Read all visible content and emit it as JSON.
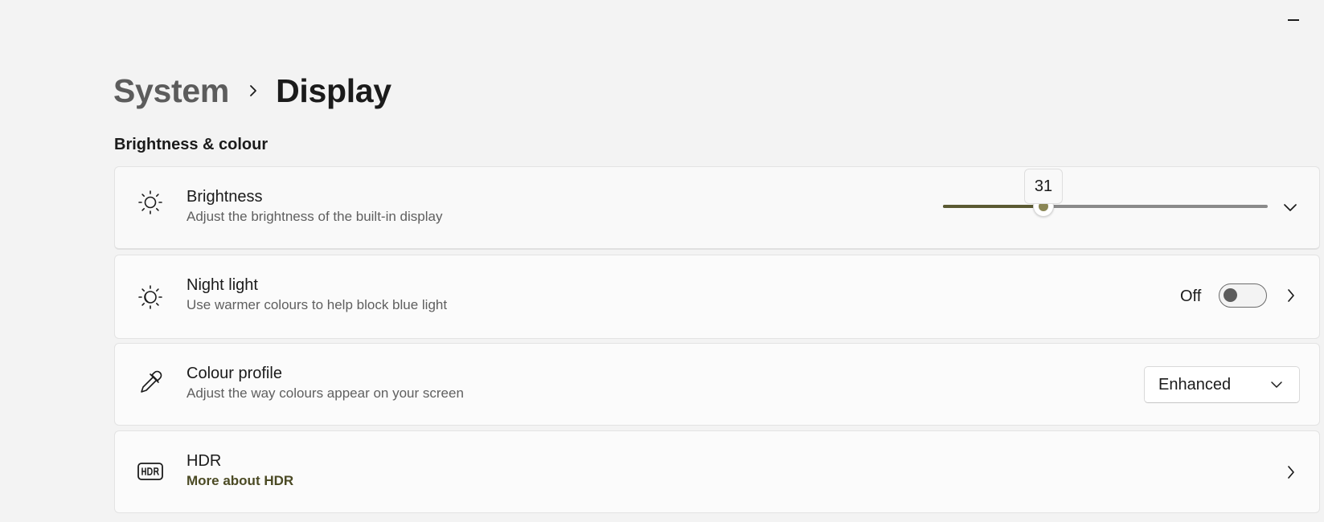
{
  "window": {
    "minimize_icon": "minimize-icon"
  },
  "breadcrumb": {
    "parent": "System",
    "separator_icon": "chevron-right-icon",
    "current": "Display"
  },
  "section": {
    "title": "Brightness & colour"
  },
  "brightness": {
    "icon": "sun-icon",
    "title": "Brightness",
    "subtitle": "Adjust the brightness of the built-in display",
    "value": 31,
    "value_label": "31",
    "expand_icon": "chevron-down-icon"
  },
  "night_light": {
    "icon": "night-light-icon",
    "title": "Night light",
    "subtitle": "Use warmer colours to help block blue light",
    "toggle_label": "Off",
    "toggle_on": false,
    "chevron_icon": "chevron-right-icon"
  },
  "colour_profile": {
    "icon": "eyedropper-icon",
    "title": "Colour profile",
    "subtitle": "Adjust the way colours appear on your screen",
    "selected": "Enhanced",
    "dropdown_icon": "chevron-down-icon"
  },
  "hdr": {
    "icon": "hdr-icon",
    "title": "HDR",
    "link": "More about HDR",
    "chevron_icon": "chevron-right-icon"
  },
  "colors": {
    "accent": "#5b5a33",
    "thumb_dot": "#8a8655",
    "link": "#4b4a24",
    "background": "#f3f3f3",
    "card": "#fbfbfb"
  }
}
